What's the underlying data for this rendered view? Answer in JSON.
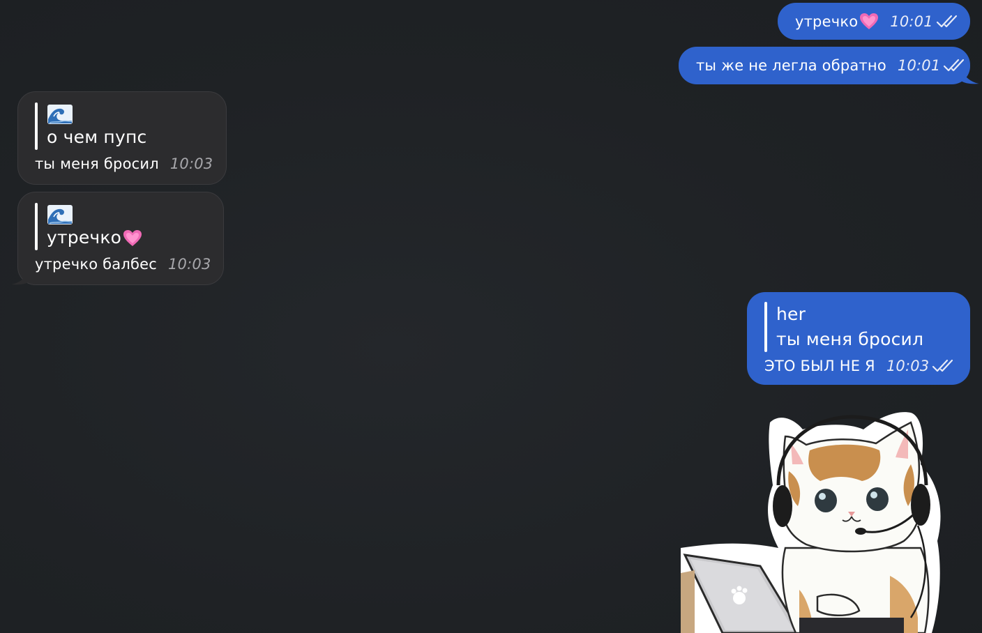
{
  "messages": [
    {
      "id": "m1",
      "direction": "outgoing",
      "text": "утречко",
      "emoji": "heart-emoji",
      "time": "10:01",
      "status": "read"
    },
    {
      "id": "m2",
      "direction": "outgoing",
      "text": "ты же не легла обратно",
      "time": "10:01",
      "status": "read"
    },
    {
      "id": "m3",
      "direction": "incoming",
      "quote": {
        "sender_icon": "wave-emoji",
        "text": "о чем пупс"
      },
      "text": "ты меня бросил",
      "time": "10:03"
    },
    {
      "id": "m4",
      "direction": "incoming",
      "quote": {
        "sender_icon": "wave-emoji",
        "text": "утречко",
        "emoji": "heart-emoji"
      },
      "text": "утречко балбес",
      "time": "10:03"
    },
    {
      "id": "m5",
      "direction": "outgoing",
      "quote": {
        "sender": "her",
        "text": "ты меня бросил"
      },
      "text": "ЭТО БЫЛ НЕ Я",
      "time": "10:03",
      "status": "read"
    },
    {
      "id": "m6",
      "direction": "outgoing",
      "type": "sticker",
      "sticker": "kitten-with-headset-laptop-sticker"
    }
  ],
  "colors": {
    "background": "#1f2225",
    "outgoing_bubble": "#2f62cc",
    "incoming_bubble": "#2c2c2e"
  }
}
